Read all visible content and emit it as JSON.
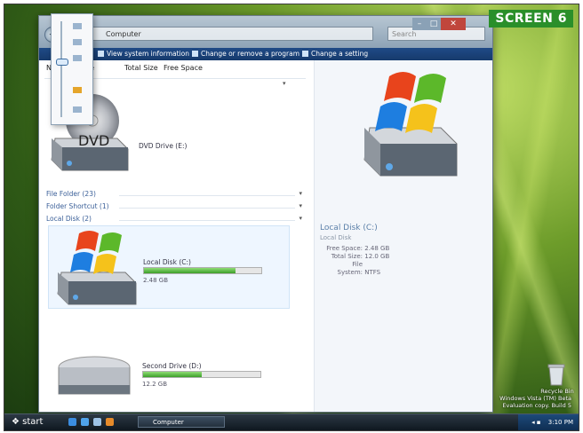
{
  "badge": "SCREEN 6",
  "window": {
    "address": "Computer",
    "search_placeholder": "Search",
    "commands": [
      {
        "label": "View system information"
      },
      {
        "label": "Change or remove a program"
      },
      {
        "label": "Change a setting"
      }
    ],
    "columns": [
      "N",
      "pe",
      "Total Size",
      "Free Space"
    ]
  },
  "groups": {
    "file_folder": "File Folder (23)",
    "folder_shortcut": "Folder Shortcut (1)",
    "local_disk": "Local Disk (2)"
  },
  "drives": {
    "dvd": {
      "icon_text": "DVD",
      "label": "DVD Drive (E:)"
    },
    "c": {
      "label": "Local Disk (C:)",
      "free_text": "2.48 GB",
      "used_fraction": 0.78
    },
    "d": {
      "label": "Second Drive (D:)",
      "free_text": "12.2 GB",
      "used_fraction": 0.5
    }
  },
  "details": {
    "title": "Local Disk (C:)",
    "subtitle": "Local Disk",
    "rows": [
      {
        "key": "Free Space:",
        "value": "2.48 GB"
      },
      {
        "key": "Total Size:",
        "value": "12.0 GB"
      },
      {
        "key": "File System:",
        "value": "NTFS"
      }
    ]
  },
  "desktop": {
    "recycle_label": "Recycle Bin",
    "watermark": [
      "Windows Vista (TM) Beta",
      "Evaluation copy. Build 5"
    ]
  },
  "taskbar": {
    "start": "start",
    "task": "Computer",
    "clock": "3:10 PM"
  }
}
